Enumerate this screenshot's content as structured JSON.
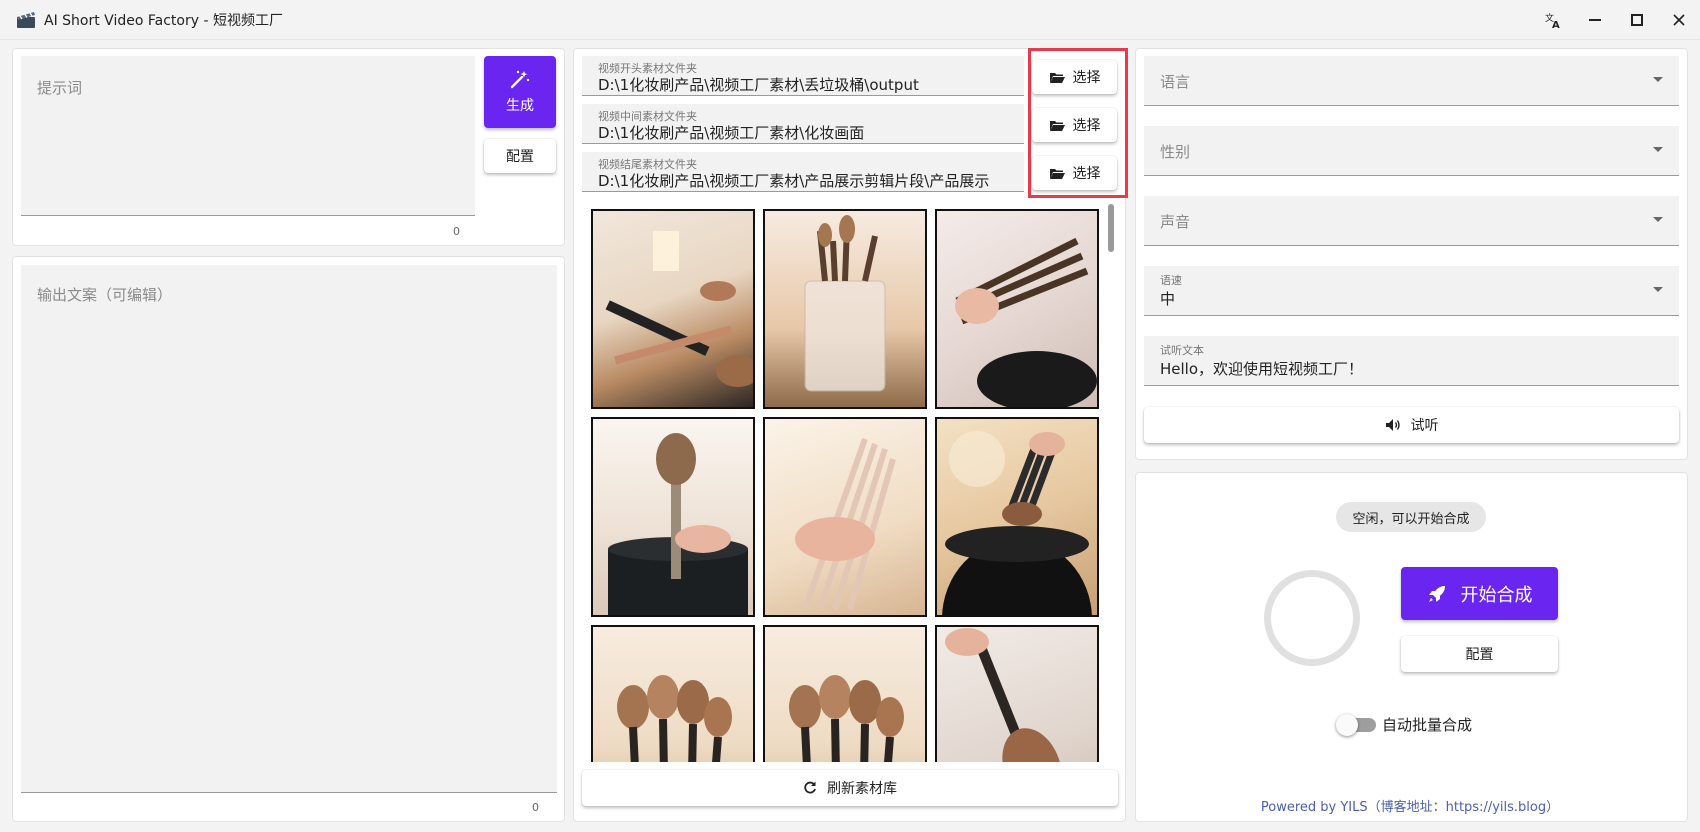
{
  "window": {
    "title": "AI Short Video Factory - 短视频工厂"
  },
  "prompt": {
    "placeholder": "提示词",
    "count": "0",
    "generate_label": "生成",
    "config_label": "配置"
  },
  "output": {
    "placeholder": "输出文案（可编辑）",
    "count": "0"
  },
  "folders": [
    {
      "label": "视频开头素材文件夹",
      "value": "D:\\1化妆刷产品\\视频工厂素材\\丢垃圾桶\\output",
      "button": "选择"
    },
    {
      "label": "视频中间素材文件夹",
      "value": "D:\\1化妆刷产品\\视频工厂素材\\化妆画面",
      "button": "选择"
    },
    {
      "label": "视频结尾素材文件夹",
      "value": "D:\\1化妆刷产品\\视频工厂素材\\产品展示剪辑片段\\产品展示",
      "button": "选择"
    }
  ],
  "refresh_label": "刷新素材库",
  "voice": {
    "language_ph": "语言",
    "gender_ph": "性别",
    "voice_ph": "声音",
    "speed_label": "语速",
    "speed_value": "中",
    "preview_label": "试听文本",
    "preview_value": "Hello，欢迎使用短视频工厂！",
    "listen_label": "试听"
  },
  "compose": {
    "status": "空闲，可以开始合成",
    "start_label": "开始合成",
    "config_label": "配置",
    "auto_batch_label": "自动批量合成",
    "auto_batch_on": false
  },
  "footer": "Powered by YILS（博客地址：https://yils.blog）",
  "colors": {
    "accent": "#6a26f0",
    "highlight": "#e53b4b",
    "link": "#4a5fb0"
  }
}
